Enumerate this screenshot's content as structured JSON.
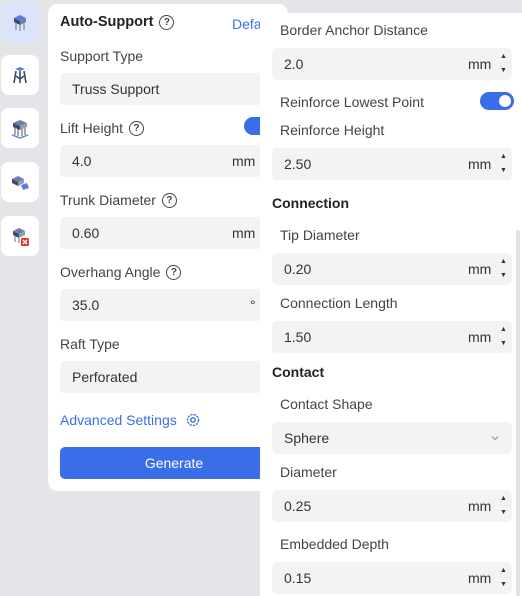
{
  "toolbar": {
    "tools": [
      {
        "name": "auto-support-tool",
        "icon": "support-cube-icon",
        "active": true
      },
      {
        "name": "manual-support-tool",
        "icon": "tree-support-icon",
        "active": false
      },
      {
        "name": "base-support-tool",
        "icon": "pillar-support-icon",
        "active": false
      },
      {
        "name": "edit-support-tool",
        "icon": "edit-support-icon",
        "active": false
      },
      {
        "name": "remove-support-tool",
        "icon": "remove-support-icon",
        "active": false
      }
    ]
  },
  "left_panel": {
    "title": "Auto-Support",
    "default_link": "Defa",
    "support_type": {
      "label": "Support Type",
      "value": "Truss Support"
    },
    "lift_height": {
      "label": "Lift Height",
      "value": "4.0",
      "unit": "mm",
      "toggle_on": true
    },
    "trunk_diameter": {
      "label": "Trunk Diameter",
      "value": "0.60",
      "unit": "mm"
    },
    "overhang_angle": {
      "label": "Overhang Angle",
      "value": "35.0",
      "unit": "°"
    },
    "raft_type": {
      "label": "Raft Type",
      "value": "Perforated"
    },
    "advanced_settings": "Advanced Settings",
    "generate": "Generate"
  },
  "right_panel": {
    "border_anchor_distance": {
      "label": "Border Anchor Distance",
      "value": "2.0",
      "unit": "mm"
    },
    "reinforce_lowest_point": {
      "label": "Reinforce Lowest Point",
      "toggle_on": true
    },
    "reinforce_height": {
      "label": "Reinforce Height",
      "value": "2.50",
      "unit": "mm"
    },
    "connection_section": "Connection",
    "tip_diameter": {
      "label": "Tip Diameter",
      "value": "0.20",
      "unit": "mm"
    },
    "connection_length": {
      "label": "Connection Length",
      "value": "1.50",
      "unit": "mm"
    },
    "contact_section": "Contact",
    "contact_shape": {
      "label": "Contact Shape",
      "value": "Sphere"
    },
    "diameter": {
      "label": "Diameter",
      "value": "0.25",
      "unit": "mm"
    },
    "embedded_depth": {
      "label": "Embedded Depth",
      "value": "0.15",
      "unit": "mm"
    }
  },
  "colors": {
    "accent": "#3a6ee8",
    "field_bg": "#f2f3f5",
    "page_bg": "#e4e5e8"
  }
}
